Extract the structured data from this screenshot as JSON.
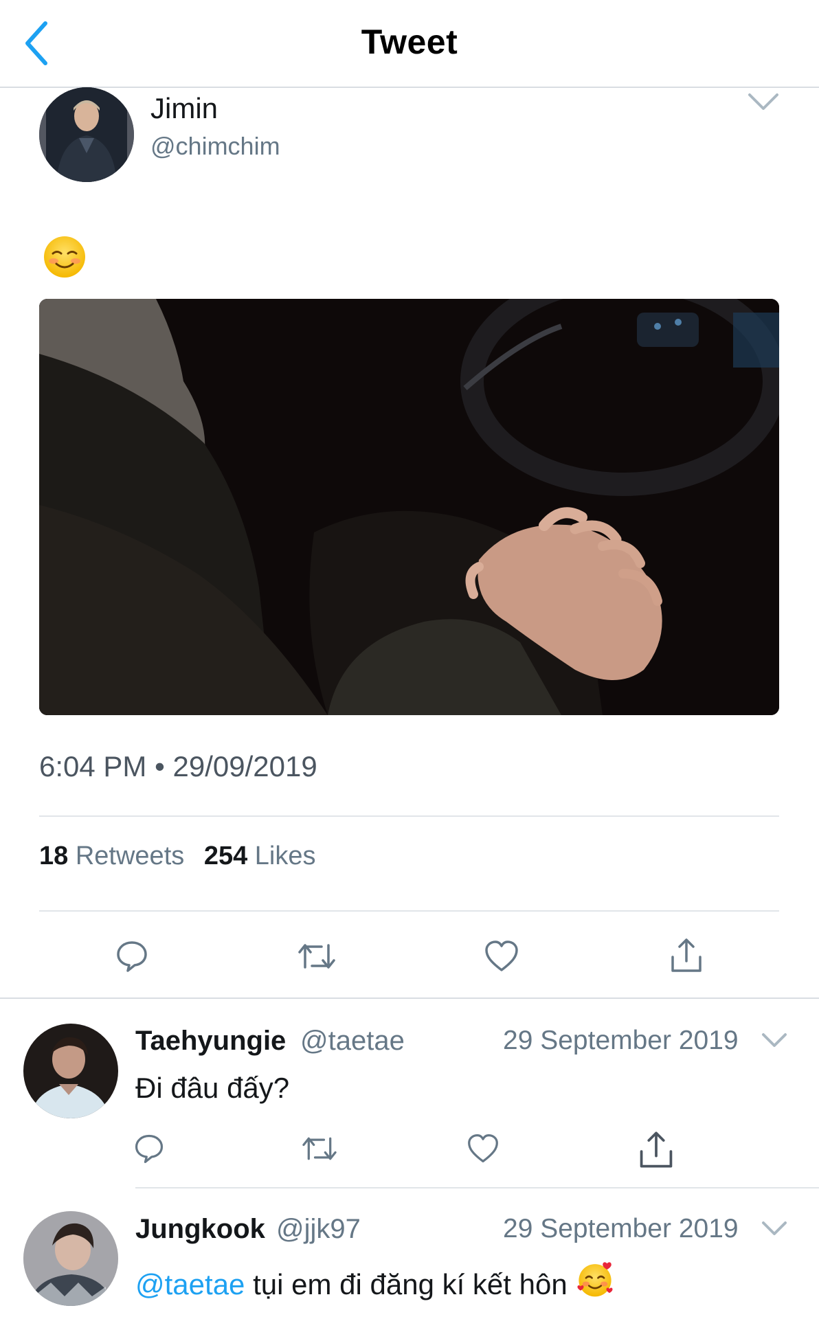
{
  "header": {
    "title": "Tweet",
    "back_icon": "chevron-left-icon",
    "accent_color": "#1da1f2"
  },
  "tweet": {
    "author": {
      "name": "Jimin",
      "handle": "@chimchim"
    },
    "text_emoji": "smiling-face-with-blush-emoji",
    "media": "photo-hands-in-car",
    "time": "6:04 PM",
    "separator": "•",
    "date": "29/09/2019",
    "stats": {
      "retweets_count": "18",
      "retweets_label": "Retweets",
      "likes_count": "254",
      "likes_label": "Likes"
    },
    "actions": [
      "reply-icon",
      "retweet-icon",
      "heart-icon",
      "share-icon"
    ]
  },
  "replies": [
    {
      "name": "Taehyungie",
      "handle": "@taetae",
      "date": "29 September 2019",
      "text": "Đi đâu đấy?"
    },
    {
      "name": "Jungkook",
      "handle": "@jjk97",
      "date": "29 September 2019",
      "mention": "@taetae",
      "text": " tụi em đi đăng kí kết hôn",
      "emoji": "smiling-face-with-hearts-emoji"
    }
  ],
  "colors": {
    "text_primary": "#14171a",
    "text_secondary": "#657786",
    "link": "#1da1f2",
    "divider": "#e1e5e9"
  }
}
